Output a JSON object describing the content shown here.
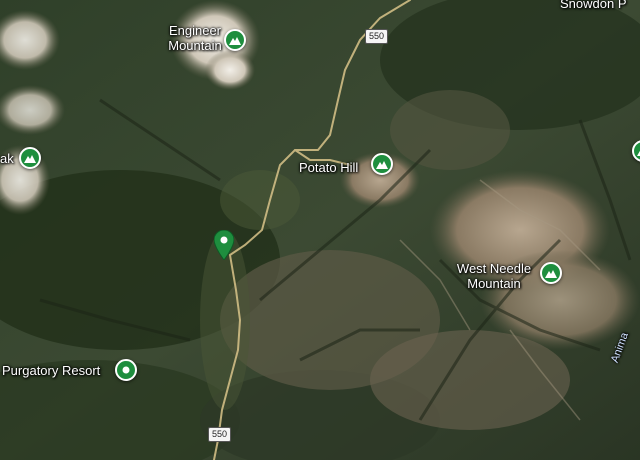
{
  "map": {
    "view": "satellite",
    "places": {
      "snowdon_peak": "Snowdon P",
      "engineer_mountain_line1": "Engineer",
      "engineer_mountain_line2": "Mountain",
      "potato_hill": "Potato Hill",
      "west_needle_line1": "West Needle",
      "west_needle_line2": "Mountain",
      "purgatory_resort": "Purgatory Resort",
      "left_peak": "ak",
      "animas_river": "Anima"
    },
    "roads": {
      "shield_top": "550",
      "shield_bottom": "550"
    },
    "colors": {
      "poi_green": "#1e8e3e",
      "road_color": "#d9c48a"
    },
    "icons": {
      "peak": "mountain-icon",
      "resort": "place-dot-icon",
      "selected": "location-pin-icon"
    }
  }
}
